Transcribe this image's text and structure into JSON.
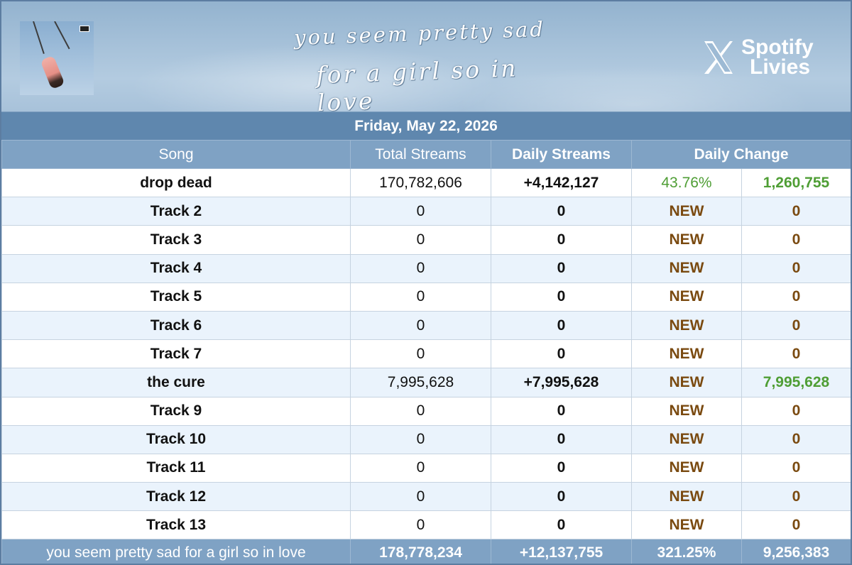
{
  "banner": {
    "album_art": "album-cover-swing",
    "script_line1": "you seem pretty sad",
    "script_line2": "for a girl so in love",
    "brand_icon": "x-logo-icon",
    "brand_line1": "Spotify",
    "brand_line2": "Livies"
  },
  "date": "Friday, May 22, 2026",
  "headers": {
    "song": "Song",
    "total": "Total Streams",
    "daily": "Daily Streams",
    "change": "Daily Change"
  },
  "rows": [
    {
      "song": "drop dead",
      "total": "170,782,606",
      "daily": "+4,142,127",
      "pct": "43.76%",
      "change": "1,260,755"
    },
    {
      "song": "Track 2",
      "total": "0",
      "daily": "0",
      "pct": "NEW",
      "change": "0"
    },
    {
      "song": "Track 3",
      "total": "0",
      "daily": "0",
      "pct": "NEW",
      "change": "0"
    },
    {
      "song": "Track 4",
      "total": "0",
      "daily": "0",
      "pct": "NEW",
      "change": "0"
    },
    {
      "song": "Track 5",
      "total": "0",
      "daily": "0",
      "pct": "NEW",
      "change": "0"
    },
    {
      "song": "Track 6",
      "total": "0",
      "daily": "0",
      "pct": "NEW",
      "change": "0"
    },
    {
      "song": "Track 7",
      "total": "0",
      "daily": "0",
      "pct": "NEW",
      "change": "0"
    },
    {
      "song": "the cure",
      "total": "7,995,628",
      "daily": "+7,995,628",
      "pct": "NEW",
      "change": "7,995,628"
    },
    {
      "song": "Track 9",
      "total": "0",
      "daily": "0",
      "pct": "NEW",
      "change": "0"
    },
    {
      "song": "Track 10",
      "total": "0",
      "daily": "0",
      "pct": "NEW",
      "change": "0"
    },
    {
      "song": "Track 11",
      "total": "0",
      "daily": "0",
      "pct": "NEW",
      "change": "0"
    },
    {
      "song": "Track 12",
      "total": "0",
      "daily": "0",
      "pct": "NEW",
      "change": "0"
    },
    {
      "song": "Track 13",
      "total": "0",
      "daily": "0",
      "pct": "NEW",
      "change": "0"
    }
  ],
  "footer": {
    "album": "you seem pretty sad for a girl so in love",
    "total": "178,778,234",
    "daily": "+12,137,755",
    "pct": "321.25%",
    "change": "9,256,383"
  },
  "colors": {
    "header_bg": "#7fa2c4",
    "date_bg": "#5f87ae",
    "positive": "#4f9e35",
    "new": "#7a4a10",
    "alt_row": "#eaf3fc"
  }
}
